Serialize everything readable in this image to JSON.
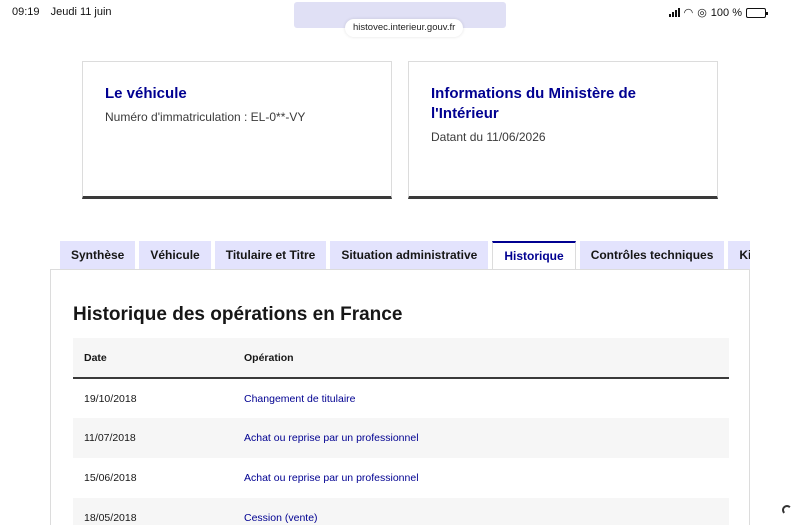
{
  "status_bar": {
    "time": "09:19",
    "date": "Jeudi 11 juin",
    "battery": "100 %"
  },
  "browser": {
    "url": "histovec.interieur.gouv.fr"
  },
  "cards": {
    "vehicle": {
      "title": "Le véhicule",
      "text": "Numéro d'immatriculation : EL-0**-VY"
    },
    "ministry": {
      "title": "Informations du Ministère de l'Intérieur",
      "text": "Datant du 11/06/2026"
    }
  },
  "tabs": [
    {
      "label": "Synthèse"
    },
    {
      "label": "Véhicule"
    },
    {
      "label": "Titulaire et Titre"
    },
    {
      "label": "Situation administrative"
    },
    {
      "label": "Historique"
    },
    {
      "label": "Contrôles techniques"
    },
    {
      "label": "Kilométrage"
    }
  ],
  "active_tab": "Historique",
  "history": {
    "title": "Historique des opérations en France",
    "columns": {
      "date": "Date",
      "operation": "Opération"
    },
    "rows": [
      {
        "date": "19/10/2018",
        "operation": "Changement de titulaire"
      },
      {
        "date": "11/07/2018",
        "operation": "Achat ou reprise par un professionnel"
      },
      {
        "date": "15/06/2018",
        "operation": "Achat ou reprise par un professionnel"
      },
      {
        "date": "18/05/2018",
        "operation": "Cession (vente)"
      }
    ]
  },
  "colors": {
    "primary": "#000091",
    "tab_bg": "#e3e3fd",
    "row_alt": "#f6f6f6"
  }
}
